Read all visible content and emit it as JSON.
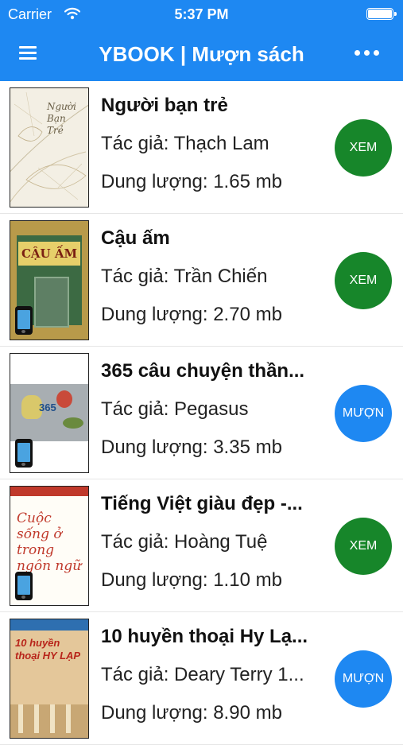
{
  "status_bar": {
    "carrier": "Carrier",
    "time": "5:37 PM"
  },
  "header": {
    "title": "YBOOK | Mượn sách"
  },
  "books": [
    {
      "title": "Người bạn trẻ",
      "author": "Tác giả: Thạch Lam",
      "size": "Dung lượng: 1.65 mb",
      "action": "XEM",
      "action_color": "#17862a",
      "cover_text": "Người Bạn Trẻ"
    },
    {
      "title": "Cậu ấm",
      "author": "Tác giả: Trần Chiến",
      "size": "Dung lượng: 2.70 mb",
      "action": "XEM",
      "action_color": "#17862a",
      "cover_text": "CẬU ẤM"
    },
    {
      "title": "365 câu chuyện thần...",
      "author": "Tác giả: Pegasus",
      "size": "Dung lượng: 3.35 mb",
      "action": "MƯỢN",
      "action_color": "#1e88f2",
      "cover_text": "365"
    },
    {
      "title": "Tiếng Việt giàu đẹp -...",
      "author": "Tác giả: Hoàng Tuệ",
      "size": "Dung lượng: 1.10 mb",
      "action": "XEM",
      "action_color": "#17862a",
      "cover_text": "Cuộc sống ở trong ngôn ngữ"
    },
    {
      "title": "10 huyền thoại Hy Lạ...",
      "author": "Tác giả: Deary Terry 1...",
      "size": "Dung lượng: 8.90 mb",
      "action": "MƯỢN",
      "action_color": "#1e88f2",
      "cover_text": "10 huyền thoại HY LẠP"
    }
  ]
}
